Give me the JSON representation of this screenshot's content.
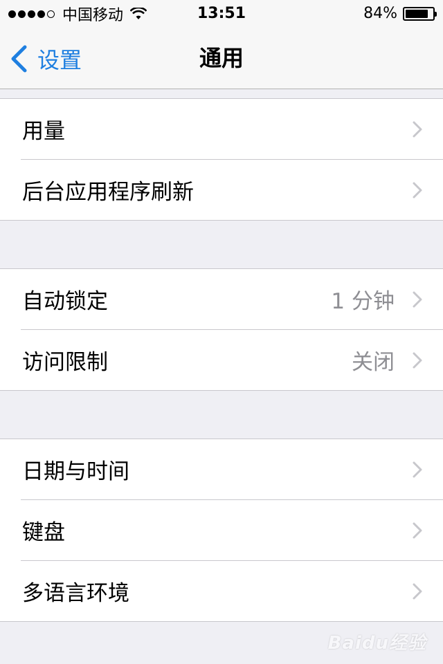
{
  "status_bar": {
    "carrier": "中国移动",
    "time": "13:51",
    "battery_text": "84%",
    "battery_level": 0.84,
    "signal_bars": 4
  },
  "nav": {
    "back_label": "设置",
    "title": "通用"
  },
  "groups": [
    {
      "rows": [
        {
          "label": "用量",
          "value": ""
        },
        {
          "label": "后台应用程序刷新",
          "value": ""
        }
      ]
    },
    {
      "rows": [
        {
          "label": "自动锁定",
          "value": "1 分钟"
        },
        {
          "label": "访问限制",
          "value": "关闭"
        }
      ]
    },
    {
      "rows": [
        {
          "label": "日期与时间",
          "value": ""
        },
        {
          "label": "键盘",
          "value": ""
        },
        {
          "label": "多语言环境",
          "value": ""
        }
      ]
    }
  ],
  "watermark": {
    "text": "Baidu经验"
  },
  "colors": {
    "accent": "#1f7fe0",
    "background": "#efeff4",
    "separator": "#c8c7cc",
    "secondary_text": "#8e8e93"
  }
}
